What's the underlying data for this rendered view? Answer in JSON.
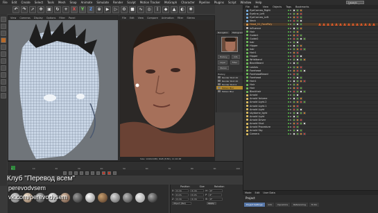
{
  "menu": [
    "File",
    "Edit",
    "Create",
    "Select",
    "Tools",
    "Mesh",
    "Snap",
    "Animate",
    "Simulate",
    "Render",
    "Sculpt",
    "Motion Tracker",
    "MoGraph",
    "Character",
    "Pipeline",
    "Plugins",
    "Script",
    "Window",
    "Help"
  ],
  "layout_label": "Layout: Standard",
  "toolbar_buttons": [
    "X",
    "Y",
    "Z"
  ],
  "viewport1": {
    "menu": [
      "View",
      "Cameras",
      "Display",
      "Options",
      "Filter",
      "Panel"
    ],
    "label": "Perspective"
  },
  "viewport2": {
    "menu": [
      "File",
      "Edit",
      "View",
      "Compare",
      "Animation",
      "Filter",
      "Stereo"
    ],
    "status": "Size: 1440x1080, RGB (8 Bit), 11:10:48"
  },
  "navigator": {
    "tabs": [
      "Navigator",
      "Histogram"
    ],
    "buttons": [
      "History",
      "Info",
      "Layer",
      "Filter",
      "Stereo"
    ],
    "history_label": "History",
    "history_items": [
      "Render Shot 20",
      "Render Shot 20",
      "Render Shot 0",
      "Motion Blur",
      "Motion Blur"
    ]
  },
  "object_manager": {
    "menu": [
      "File",
      "Edit",
      "View",
      "Objects",
      "Tags",
      "Bookmarks"
    ],
    "objects": [
      "EyeCornea_Right",
      "Eyeline_Left",
      "EyeCornea_Left",
      "Neck",
      "Head_V1_FacePoly",
      "Influence",
      "Hair",
      "Guide1",
      "Guide2",
      "hair",
      "Hipper",
      "hair",
      "Hair1",
      "Hipper",
      "Wristband",
      "BlackBeard",
      "Lashes",
      "Forehead",
      "ForeheadBeard",
      "Forehead",
      "Hair1",
      "Hair",
      "Hair",
      "Blackhair",
      "Arnold",
      "Arnold Volume",
      "Arnold Light.2",
      "Arnold Light.1",
      "Arnold Light",
      "skydome_light",
      "Arnold Light",
      "Arnold Driver",
      "Arnold Shut",
      "Arnold Procedure",
      "Arnold Sky",
      "Camera"
    ]
  },
  "attributes": {
    "menu": [
      "Mode",
      "Edit",
      "User Data"
    ],
    "tabs": [
      "Project Settings",
      "Info",
      "Dynamics",
      "Referencing",
      "To Do"
    ],
    "active_tab": "Project Settings",
    "title": "Project"
  },
  "timeline": {
    "ticks": [
      "0",
      "10",
      "20",
      "30",
      "40",
      "50",
      "60",
      "70",
      "80",
      "90",
      "100"
    ]
  },
  "coordinates": {
    "headers": [
      "Position",
      "Size",
      "Rotation"
    ],
    "rows": [
      [
        "X",
        "0 cm",
        "0 cm",
        "H",
        "0°"
      ],
      [
        "Y",
        "0 cm",
        "0 cm",
        "P",
        "0°"
      ],
      [
        "Z",
        "0 cm",
        "0 cm",
        "B",
        "0°"
      ]
    ],
    "mode": "Object (Rel)",
    "apply": "Apply"
  },
  "watermark": {
    "line1": "Клуб \"Перевод всем\"",
    "line2": "perevodvsem",
    "line3": "vk.com/perevodvsem"
  },
  "colors": {
    "accent": "#5777a8",
    "keyframe_green": "#2f8a3c",
    "warning": "#e35a2a"
  }
}
